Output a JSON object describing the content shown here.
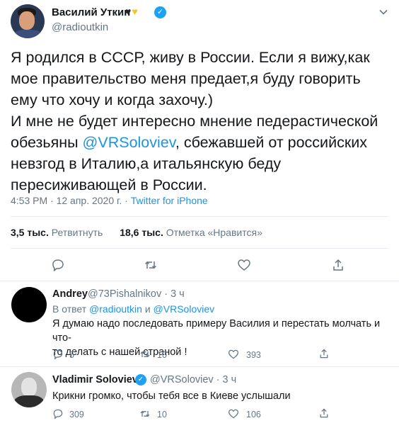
{
  "tweet": {
    "author_name": "Василий Уткин",
    "author_emoji_1": "♥",
    "author_emoji_2": "♥",
    "verified_mark": "✓",
    "author_handle": "@radioutkin",
    "text_line1": "Я родился в СССР, живу в России. Если я вижу,как",
    "text_line2": "мое правительство меня предает,я буду говорить",
    "text_line3": "ему что хочу и когда захочу.)",
    "text_line4": "И мне не будет интересно мнение педерастической",
    "text_line5_pre": "обезьяны ",
    "text_line5_mention": "@VRSoloviev",
    "text_line5_post": ", сбежавшей от российских",
    "text_line6": "невзгод в Италию,а итальянскую беду",
    "text_line7": "пересиживающей в России.",
    "time": "4:53 PM · 12 апр. 2020 г. · ",
    "source": "Twitter for iPhone",
    "retweets_count": "3,5 тыс.",
    "retweets_label": "Ретвитнуть",
    "likes_count": "18,6 тыс.",
    "likes_label": "Отметка «Нравится»"
  },
  "replies": [
    {
      "name": "Andrey",
      "handle_time": "@73Pishalnikov · 3 ч",
      "reply_to_prefix": "В ответ ",
      "reply_to_user1": "@radioutkin",
      "reply_to_and": " и ",
      "reply_to_user2": "@VRSoloviev",
      "text_line1": "Я думаю надо последовать примеру Василия и перестать молчать и что-",
      "text_line2": "то делать с нашей страной !",
      "replies": "5",
      "retweets": "10",
      "likes": "393"
    },
    {
      "name": "Vladimir Soloviev",
      "verified_mark": "✓",
      "handle_time": "@VRSoloviev · 3 ч",
      "text_line1": "Крикни громко, чтобы тебя все в Киеве услышали",
      "replies": "309",
      "retweets": "10",
      "likes": "106"
    }
  ],
  "icons": [
    "caret-down-icon",
    "reply-icon",
    "retweet-icon",
    "like-icon",
    "share-icon"
  ],
  "colors": {
    "link": "#1b95e0",
    "verified": "#1da1f2",
    "muted": "#657786",
    "text": "#14171a"
  }
}
